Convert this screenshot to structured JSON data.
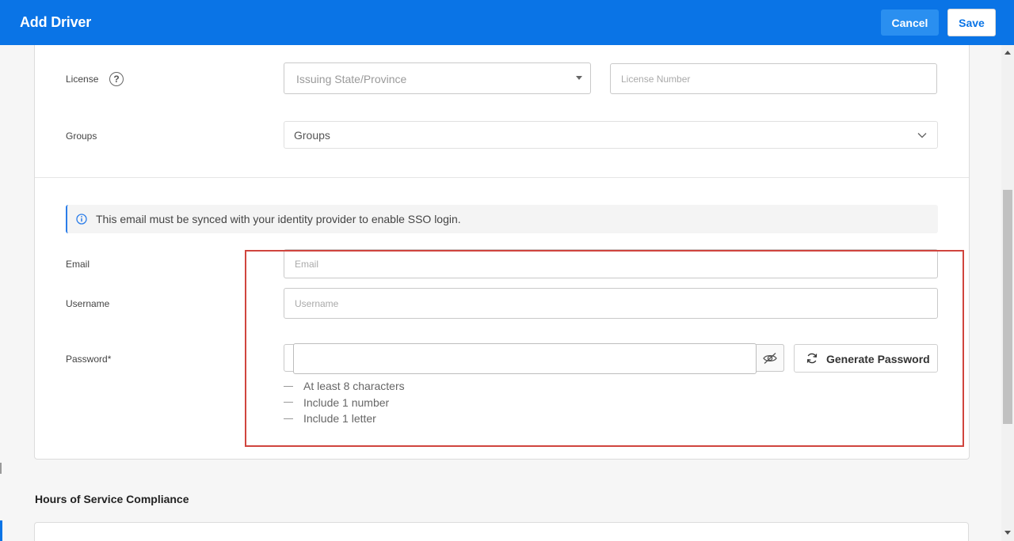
{
  "header": {
    "title": "Add Driver",
    "cancel_label": "Cancel",
    "save_label": "Save"
  },
  "form": {
    "license": {
      "label": "License",
      "help": "?",
      "state_placeholder": "Issuing State/Province",
      "number_placeholder": "License Number"
    },
    "groups": {
      "label": "Groups",
      "value": "Groups"
    },
    "info_banner": "This email must be synced with your identity provider to enable SSO login.",
    "email": {
      "label": "Email",
      "placeholder": "Email"
    },
    "username": {
      "label": "Username",
      "placeholder": "Username"
    },
    "password": {
      "label": "Password*",
      "generate_label": "Generate Password",
      "rules": [
        "At least 8 characters",
        "Include 1 number",
        "Include 1 letter"
      ]
    }
  },
  "sections": {
    "hos_title": "Hours of Service Compliance"
  },
  "icons": {
    "help": "help-circle-icon",
    "caret": "caret-down-icon",
    "chevron": "chevron-down-icon",
    "info": "info-icon",
    "eye": "eye-off-icon",
    "refresh": "refresh-icon"
  },
  "colors": {
    "brand": "#0a74e6",
    "highlight": "#d0453e",
    "info_accent": "#2b7de9"
  }
}
